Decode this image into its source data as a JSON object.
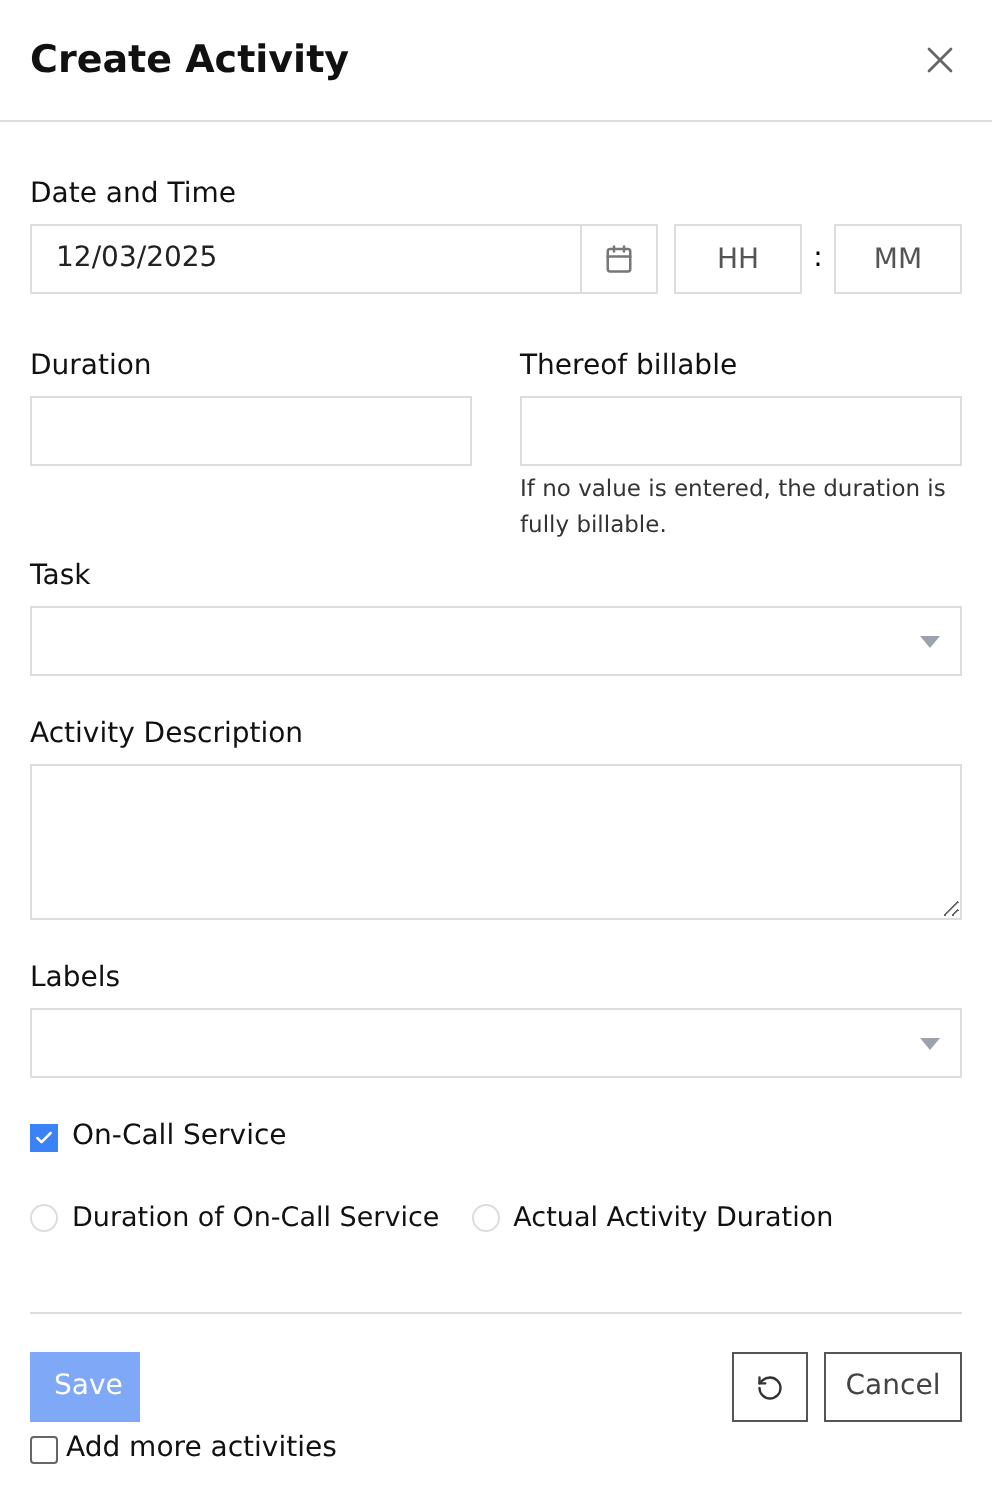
{
  "dialog": {
    "title": "Create Activity"
  },
  "date_time": {
    "label": "Date and Time",
    "date_value": "12/03/2025",
    "hour_placeholder": "HH",
    "separator": ":",
    "minute_placeholder": "MM"
  },
  "duration": {
    "label": "Duration"
  },
  "billable": {
    "label": "Thereof billable",
    "hint": "If no value is entered, the duration is fully billable."
  },
  "task": {
    "label": "Task"
  },
  "description": {
    "label": "Activity Description"
  },
  "labels": {
    "label": "Labels"
  },
  "on_call": {
    "label": "On-Call Service",
    "checked": true
  },
  "radios": [
    {
      "label": "Duration of On-Call Service",
      "selected": false
    },
    {
      "label": "Actual Activity Duration",
      "selected": false
    }
  ],
  "save": {
    "label": "Save",
    "disabled": true
  },
  "cancel": {
    "label": "Cancel"
  },
  "add_more": {
    "label": "Add more activities",
    "checked": false
  }
}
